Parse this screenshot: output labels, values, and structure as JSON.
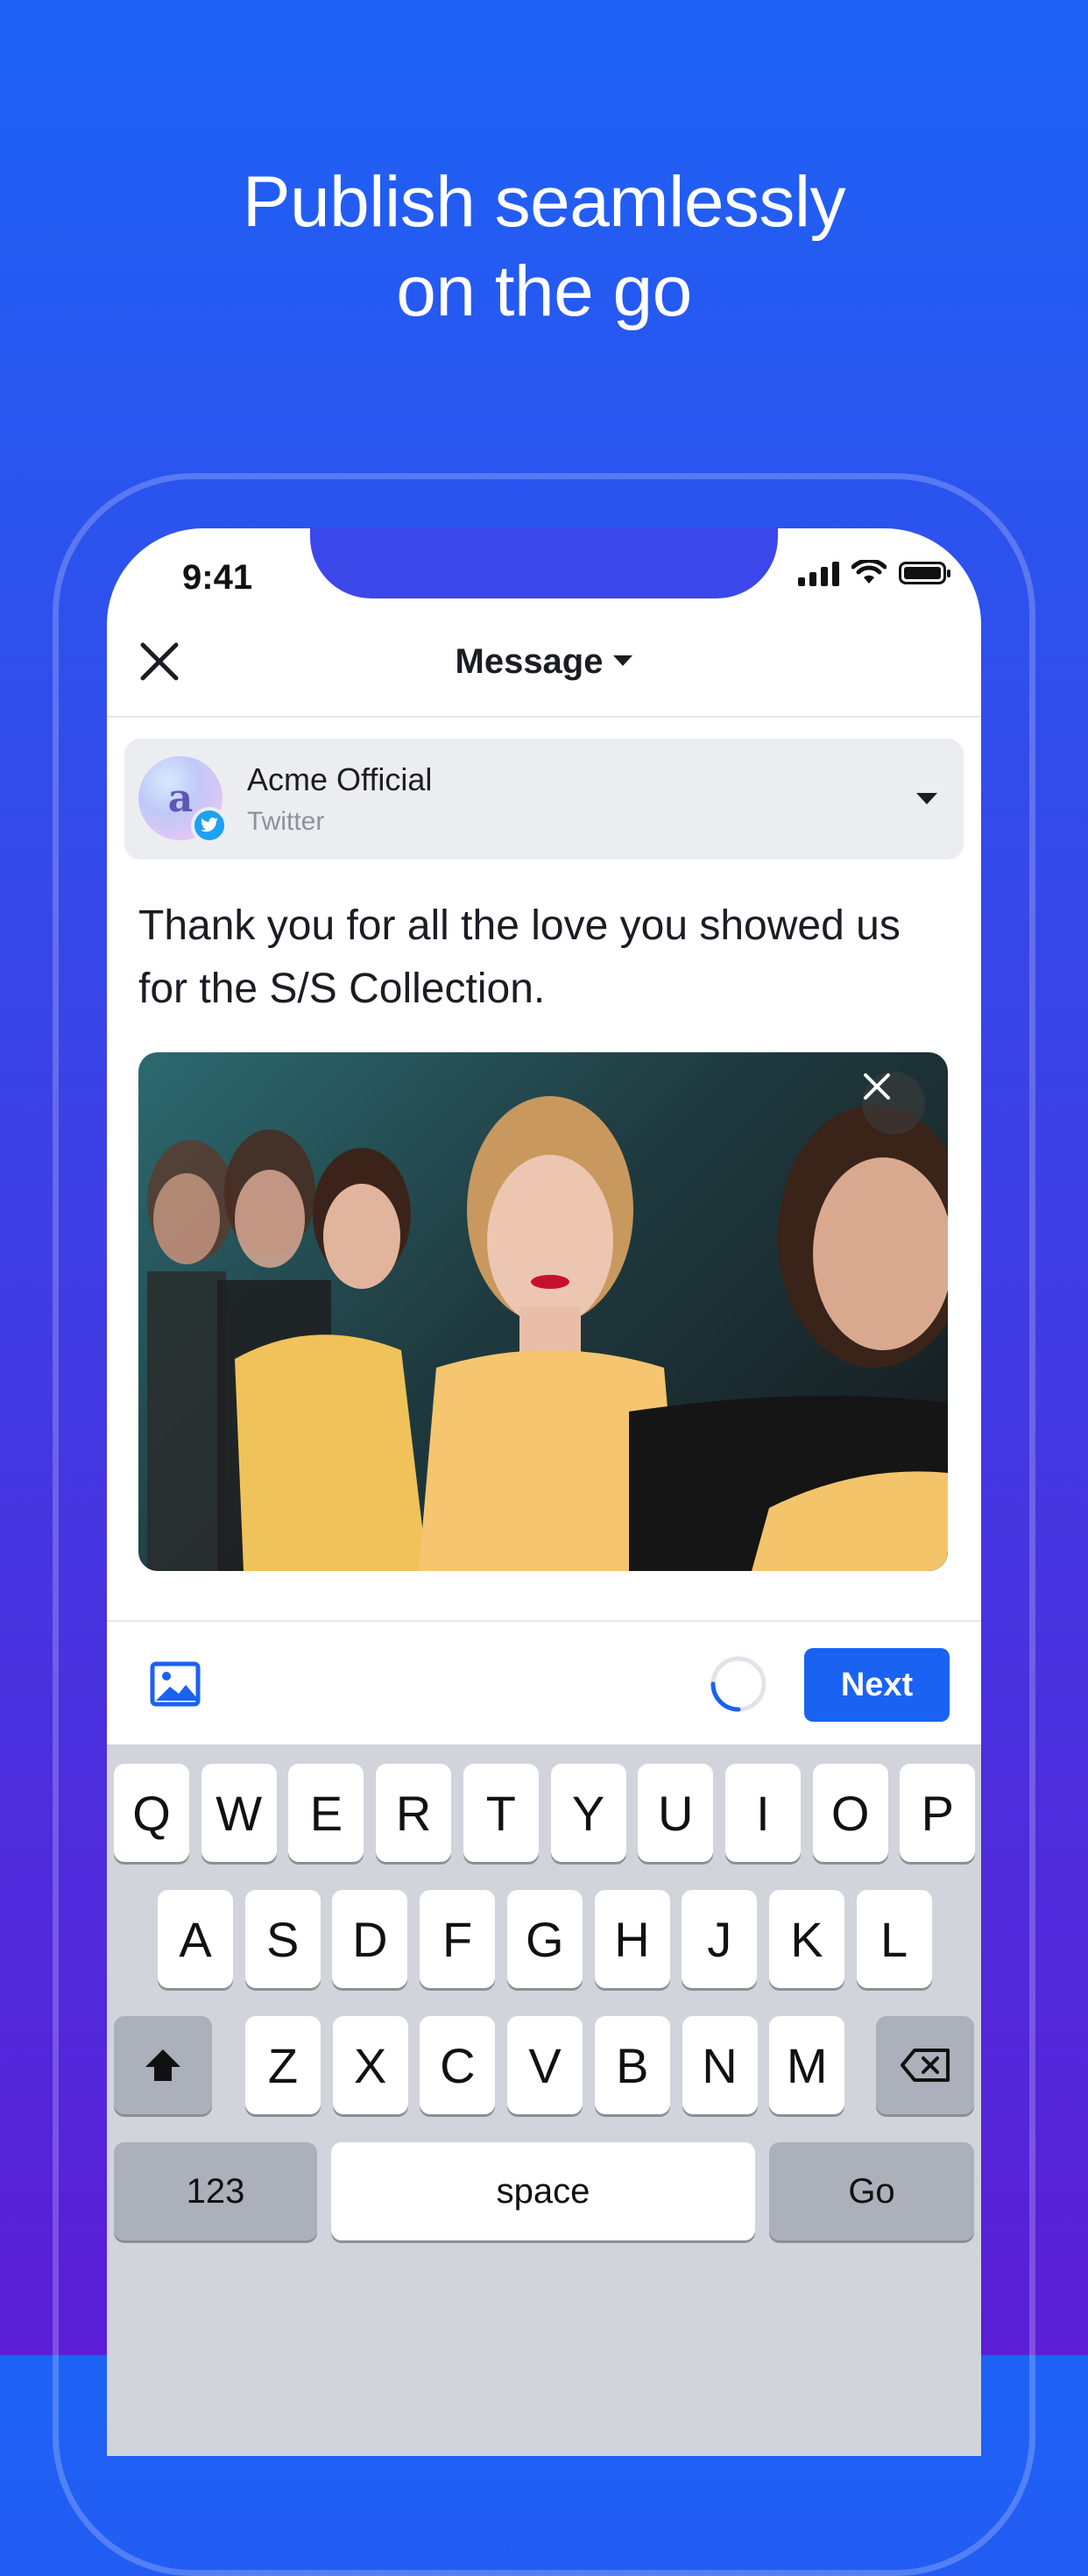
{
  "headline": [
    "Publish seamlessly",
    "on the go"
  ],
  "status_bar": {
    "time": "9:41"
  },
  "topbar": {
    "title": "Message",
    "close_icon": "close-icon"
  },
  "account": {
    "avatar_letter": "a",
    "name": "Acme Official",
    "network": "Twitter"
  },
  "message": {
    "text": "Thank you for all the love you showed us for the S/S Collection."
  },
  "photo": {
    "description_icon": "image-attachment",
    "remove_icon": "close-icon"
  },
  "composer": {
    "next_label": "Next",
    "progress": 0.25
  },
  "keyboard": {
    "row1": [
      "Q",
      "W",
      "E",
      "R",
      "T",
      "Y",
      "U",
      "I",
      "O",
      "P"
    ],
    "row2": [
      "A",
      "S",
      "D",
      "F",
      "G",
      "H",
      "J",
      "K",
      "L"
    ],
    "row3": [
      "Z",
      "X",
      "C",
      "V",
      "B",
      "N",
      "M"
    ],
    "numbers_label": "123",
    "space_label": "space",
    "go_label": "Go"
  },
  "colors": {
    "accent": "#1a62f2",
    "background_top": "#1d63f6",
    "background_bottom": "#5a1ed6",
    "twitter": "#1da1f2"
  }
}
